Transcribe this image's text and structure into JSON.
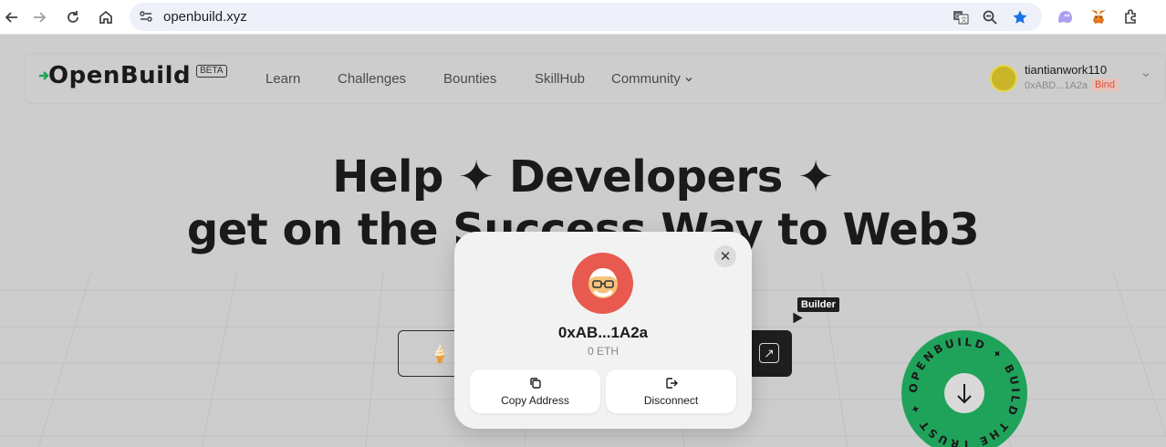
{
  "browser": {
    "url": "openbuild.xyz",
    "back_icon": "back-arrow-icon",
    "forward_icon": "forward-arrow-icon",
    "reload_icon": "reload-icon",
    "home_icon": "home-icon"
  },
  "header": {
    "logo": "OpenBuild",
    "beta": "BETA",
    "nav": {
      "learn": "Learn",
      "challenges": "Challenges",
      "bounties": "Bounties",
      "skillhub": "SkillHub",
      "community": "Community"
    },
    "user": {
      "name": "tiantianwork110",
      "address": "0xABD...1A2a",
      "bind": "Bind"
    }
  },
  "hero": {
    "line1": "Help ✦ Developers ✦",
    "line2": "get on the Success Way to Web3"
  },
  "builder_tag": "Builder",
  "badge_text": "OPENBUILD ✦ BUILD THE TRUST ✦",
  "modal": {
    "address": "0xAB...1A2a",
    "balance": "0 ETH",
    "copy_label": "Copy Address",
    "disconnect_label": "Disconnect"
  },
  "colors": {
    "badge_green": "#1fa35a",
    "avatar_red": "#e85a4f",
    "bind_red": "#d8553a",
    "star_blue": "#1a73e8"
  }
}
